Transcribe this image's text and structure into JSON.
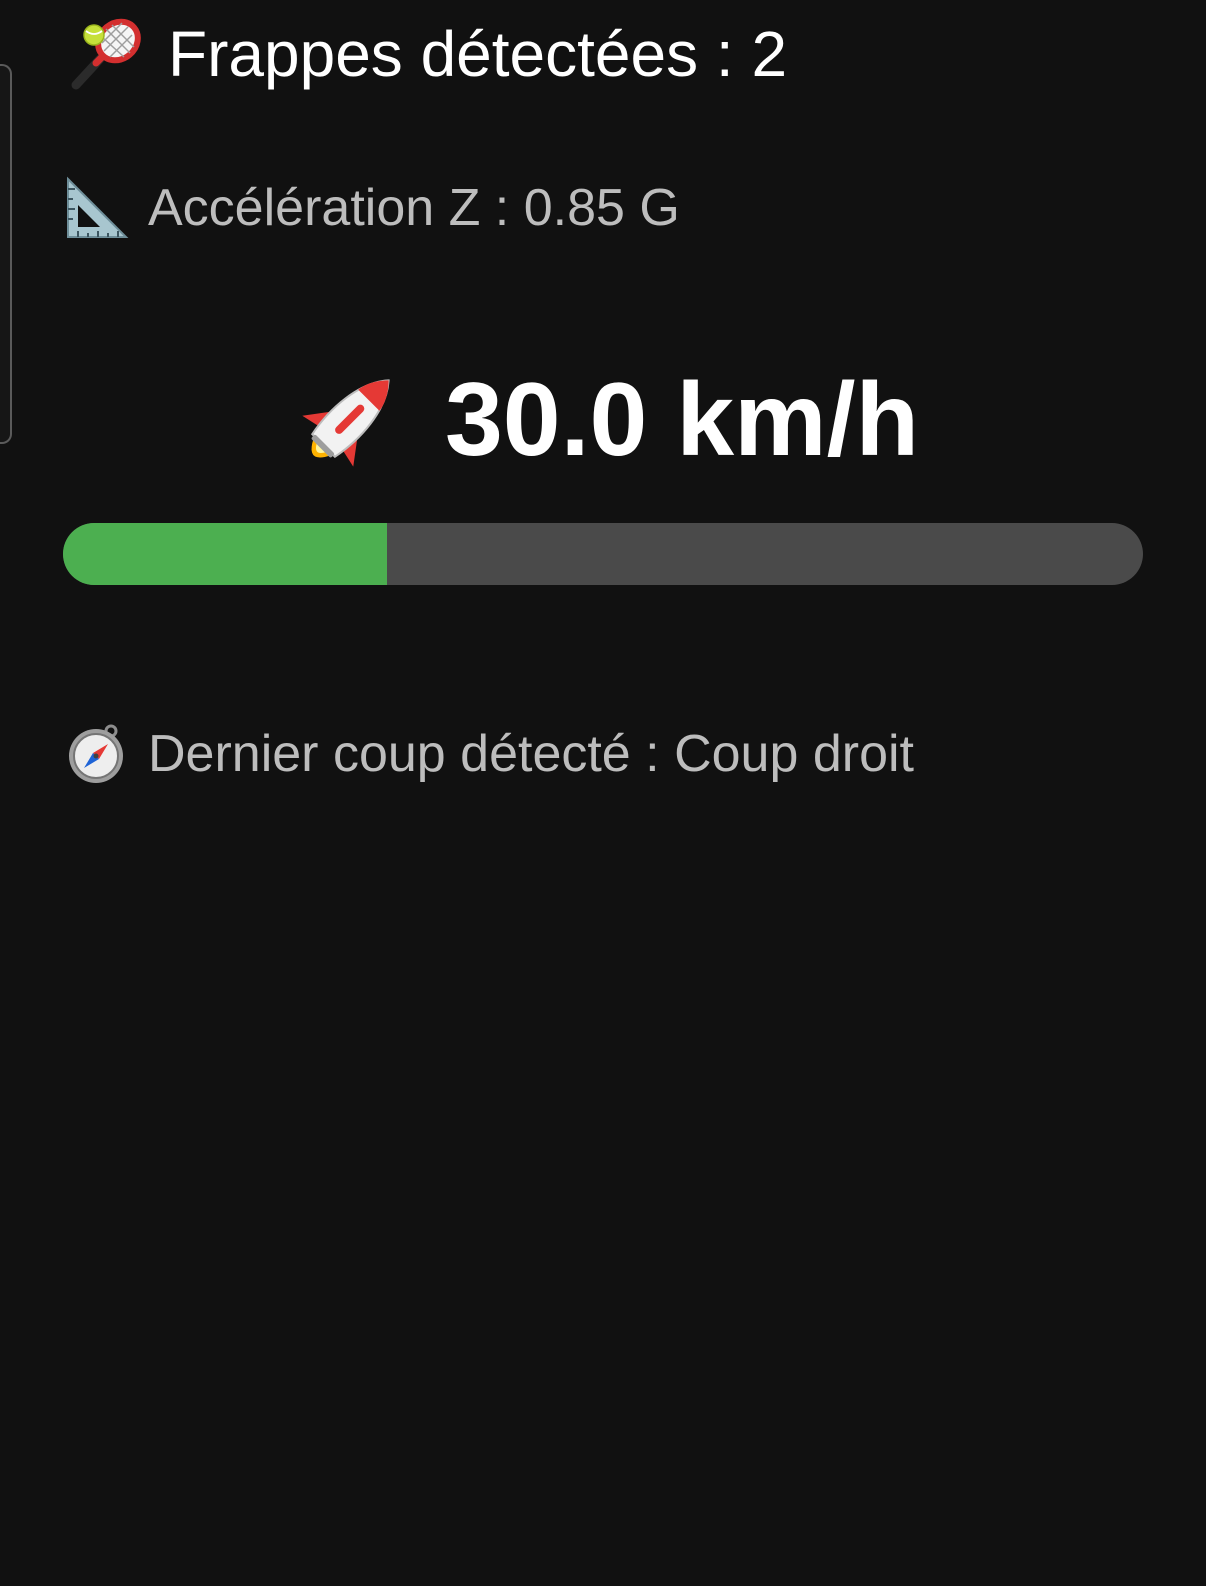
{
  "hits": {
    "icon": "tennis-racket-icon",
    "text": "Frappes détectées : 2"
  },
  "acceleration": {
    "icon": "triangular-ruler-icon",
    "text": "Accélération Z : 0.85 G"
  },
  "speed": {
    "icon": "rocket-icon",
    "text": "30.0 km/h",
    "progress_percent": 30,
    "bar_color": "#4caf50",
    "track_color": "#4a4a4a"
  },
  "last_stroke": {
    "icon": "compass-icon",
    "text": "Dernier coup détecté : Coup droit"
  },
  "colors": {
    "background": "#111111",
    "primary_text": "#ffffff",
    "secondary_text": "#bdbdbd"
  }
}
